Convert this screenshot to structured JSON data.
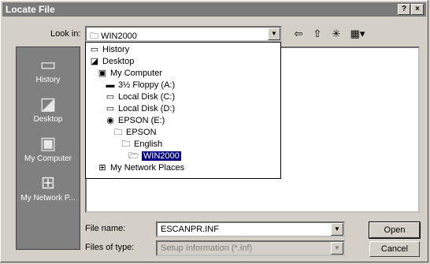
{
  "window": {
    "title": "Locate File",
    "help_label": "?",
    "close_label": "×"
  },
  "lookin": {
    "label": "Look in:",
    "value": "WIN2000"
  },
  "toolbar": {
    "back_icon": "⇦",
    "up_icon": "⇧",
    "newfolder_icon": "✳",
    "views_icon": "▦"
  },
  "places": [
    {
      "label": "History",
      "icon": "history-icon"
    },
    {
      "label": "Desktop",
      "icon": "desktop-icon"
    },
    {
      "label": "My Computer",
      "icon": "computer-icon"
    },
    {
      "label": "My Network P...",
      "icon": "network-icon"
    }
  ],
  "dropdown": [
    {
      "label": "History"
    },
    {
      "label": "Desktop"
    },
    {
      "label": "My Computer"
    },
    {
      "label": "3½ Floppy (A:)"
    },
    {
      "label": "Local Disk (C:)"
    },
    {
      "label": "Local Disk (D:)"
    },
    {
      "label": "EPSON (E:)"
    },
    {
      "label": "EPSON"
    },
    {
      "label": "English"
    },
    {
      "label": "WIN2000"
    },
    {
      "label": "My Network Places"
    }
  ],
  "filename": {
    "label": "File name:",
    "value": "ESCANPR.INF"
  },
  "filetype": {
    "label": "Files of type:",
    "value": "Setup Information (*.inf)"
  },
  "buttons": {
    "open": "Open",
    "cancel": "Cancel"
  }
}
